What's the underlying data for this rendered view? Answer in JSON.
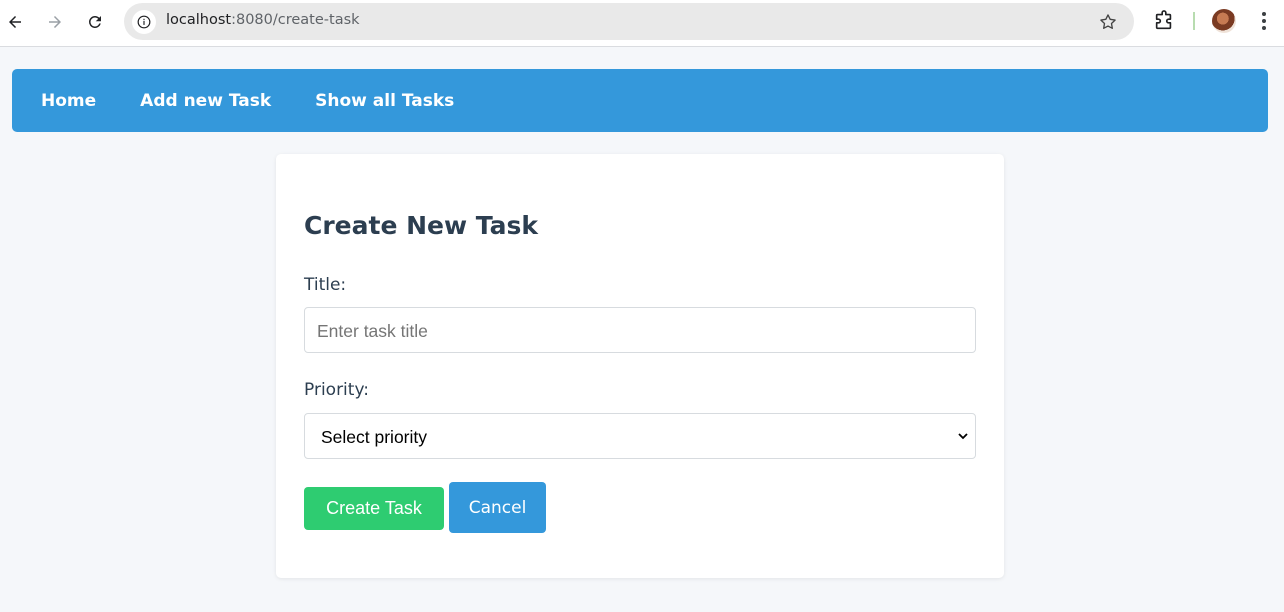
{
  "browser": {
    "url_host": "localhost",
    "url_path": ":8080/create-task",
    "icons": [
      "back-icon",
      "forward-icon",
      "reload-icon",
      "site-info-icon",
      "bookmark-star-icon",
      "extensions-icon",
      "profile-avatar",
      "menu-kebab-icon"
    ]
  },
  "nav": {
    "items": [
      {
        "label": "Home"
      },
      {
        "label": "Add new Task"
      },
      {
        "label": "Show all Tasks"
      }
    ],
    "color": "#3498db"
  },
  "form": {
    "heading": "Create New Task",
    "title_label": "Title:",
    "title_placeholder": "Enter task title",
    "priority_label": "Priority:",
    "priority_selected": "Select priority",
    "create_label": "Create Task",
    "cancel_label": "Cancel",
    "create_color": "#2ecc71",
    "cancel_color": "#3498db"
  }
}
